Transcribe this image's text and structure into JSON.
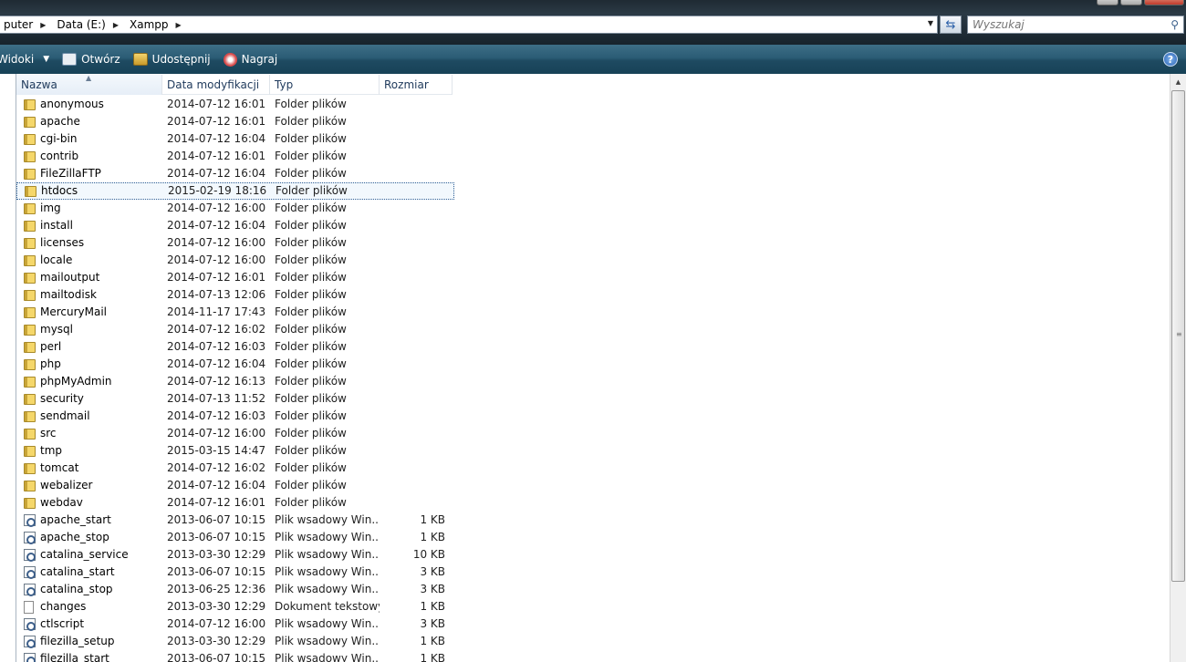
{
  "address": {
    "crumbs": [
      "puter",
      "Data (E:)",
      "Xampp"
    ]
  },
  "search": {
    "placeholder": "Wyszukaj"
  },
  "toolbar": {
    "views": "Widoki",
    "open": "Otwórz",
    "share": "Udostępnij",
    "burn": "Nagraj",
    "help": "?"
  },
  "columns": {
    "name": "Nazwa",
    "date": "Data modyfikacji",
    "type": "Typ",
    "size": "Rozmiar"
  },
  "files": [
    {
      "name": "anonymous",
      "date": "2014-07-12 16:01",
      "type": "Folder plików",
      "size": "",
      "icon": "folder-icon"
    },
    {
      "name": "apache",
      "date": "2014-07-12 16:01",
      "type": "Folder plików",
      "size": "",
      "icon": "folder-icon"
    },
    {
      "name": "cgi-bin",
      "date": "2014-07-12 16:04",
      "type": "Folder plików",
      "size": "",
      "icon": "folder-icon"
    },
    {
      "name": "contrib",
      "date": "2014-07-12 16:01",
      "type": "Folder plików",
      "size": "",
      "icon": "folder-icon"
    },
    {
      "name": "FileZillaFTP",
      "date": "2014-07-12 16:04",
      "type": "Folder plików",
      "size": "",
      "icon": "folder-icon"
    },
    {
      "name": "htdocs",
      "date": "2015-02-19 18:16",
      "type": "Folder plików",
      "size": "",
      "icon": "folder-icon",
      "selected": true
    },
    {
      "name": "img",
      "date": "2014-07-12 16:00",
      "type": "Folder plików",
      "size": "",
      "icon": "folder-icon"
    },
    {
      "name": "install",
      "date": "2014-07-12 16:04",
      "type": "Folder plików",
      "size": "",
      "icon": "folder-icon"
    },
    {
      "name": "licenses",
      "date": "2014-07-12 16:00",
      "type": "Folder plików",
      "size": "",
      "icon": "folder-icon"
    },
    {
      "name": "locale",
      "date": "2014-07-12 16:00",
      "type": "Folder plików",
      "size": "",
      "icon": "folder-icon"
    },
    {
      "name": "mailoutput",
      "date": "2014-07-12 16:01",
      "type": "Folder plików",
      "size": "",
      "icon": "folder-icon"
    },
    {
      "name": "mailtodisk",
      "date": "2014-07-13 12:06",
      "type": "Folder plików",
      "size": "",
      "icon": "folder-icon"
    },
    {
      "name": "MercuryMail",
      "date": "2014-11-17 17:43",
      "type": "Folder plików",
      "size": "",
      "icon": "folder-icon"
    },
    {
      "name": "mysql",
      "date": "2014-07-12 16:02",
      "type": "Folder plików",
      "size": "",
      "icon": "folder-icon"
    },
    {
      "name": "perl",
      "date": "2014-07-12 16:03",
      "type": "Folder plików",
      "size": "",
      "icon": "folder-icon"
    },
    {
      "name": "php",
      "date": "2014-07-12 16:04",
      "type": "Folder plików",
      "size": "",
      "icon": "folder-icon"
    },
    {
      "name": "phpMyAdmin",
      "date": "2014-07-12 16:13",
      "type": "Folder plików",
      "size": "",
      "icon": "folder-icon"
    },
    {
      "name": "security",
      "date": "2014-07-13 11:52",
      "type": "Folder plików",
      "size": "",
      "icon": "folder-icon"
    },
    {
      "name": "sendmail",
      "date": "2014-07-12 16:03",
      "type": "Folder plików",
      "size": "",
      "icon": "folder-icon"
    },
    {
      "name": "src",
      "date": "2014-07-12 16:00",
      "type": "Folder plików",
      "size": "",
      "icon": "folder-icon"
    },
    {
      "name": "tmp",
      "date": "2015-03-15 14:47",
      "type": "Folder plików",
      "size": "",
      "icon": "folder-icon"
    },
    {
      "name": "tomcat",
      "date": "2014-07-12 16:02",
      "type": "Folder plików",
      "size": "",
      "icon": "folder-icon"
    },
    {
      "name": "webalizer",
      "date": "2014-07-12 16:04",
      "type": "Folder plików",
      "size": "",
      "icon": "folder-icon"
    },
    {
      "name": "webdav",
      "date": "2014-07-12 16:01",
      "type": "Folder plików",
      "size": "",
      "icon": "folder-icon"
    },
    {
      "name": "apache_start",
      "date": "2013-06-07 10:15",
      "type": "Plik wsadowy Win...",
      "size": "1 KB",
      "icon": "batch-file-icon"
    },
    {
      "name": "apache_stop",
      "date": "2013-06-07 10:15",
      "type": "Plik wsadowy Win...",
      "size": "1 KB",
      "icon": "batch-file-icon"
    },
    {
      "name": "catalina_service",
      "date": "2013-03-30 12:29",
      "type": "Plik wsadowy Win...",
      "size": "10 KB",
      "icon": "batch-file-icon"
    },
    {
      "name": "catalina_start",
      "date": "2013-06-07 10:15",
      "type": "Plik wsadowy Win...",
      "size": "3 KB",
      "icon": "batch-file-icon"
    },
    {
      "name": "catalina_stop",
      "date": "2013-06-25 12:36",
      "type": "Plik wsadowy Win...",
      "size": "3 KB",
      "icon": "batch-file-icon"
    },
    {
      "name": "changes",
      "date": "2013-03-30 12:29",
      "type": "Dokument tekstowy",
      "size": "1 KB",
      "icon": "text-file-icon"
    },
    {
      "name": "ctlscript",
      "date": "2014-07-12 16:00",
      "type": "Plik wsadowy Win...",
      "size": "3 KB",
      "icon": "batch-file-icon"
    },
    {
      "name": "filezilla_setup",
      "date": "2013-03-30 12:29",
      "type": "Plik wsadowy Win...",
      "size": "1 KB",
      "icon": "batch-file-icon"
    },
    {
      "name": "filezilla_start",
      "date": "2013-06-07 10:15",
      "type": "Plik wsadowy Win...",
      "size": "1 KB",
      "icon": "batch-file-icon"
    }
  ]
}
